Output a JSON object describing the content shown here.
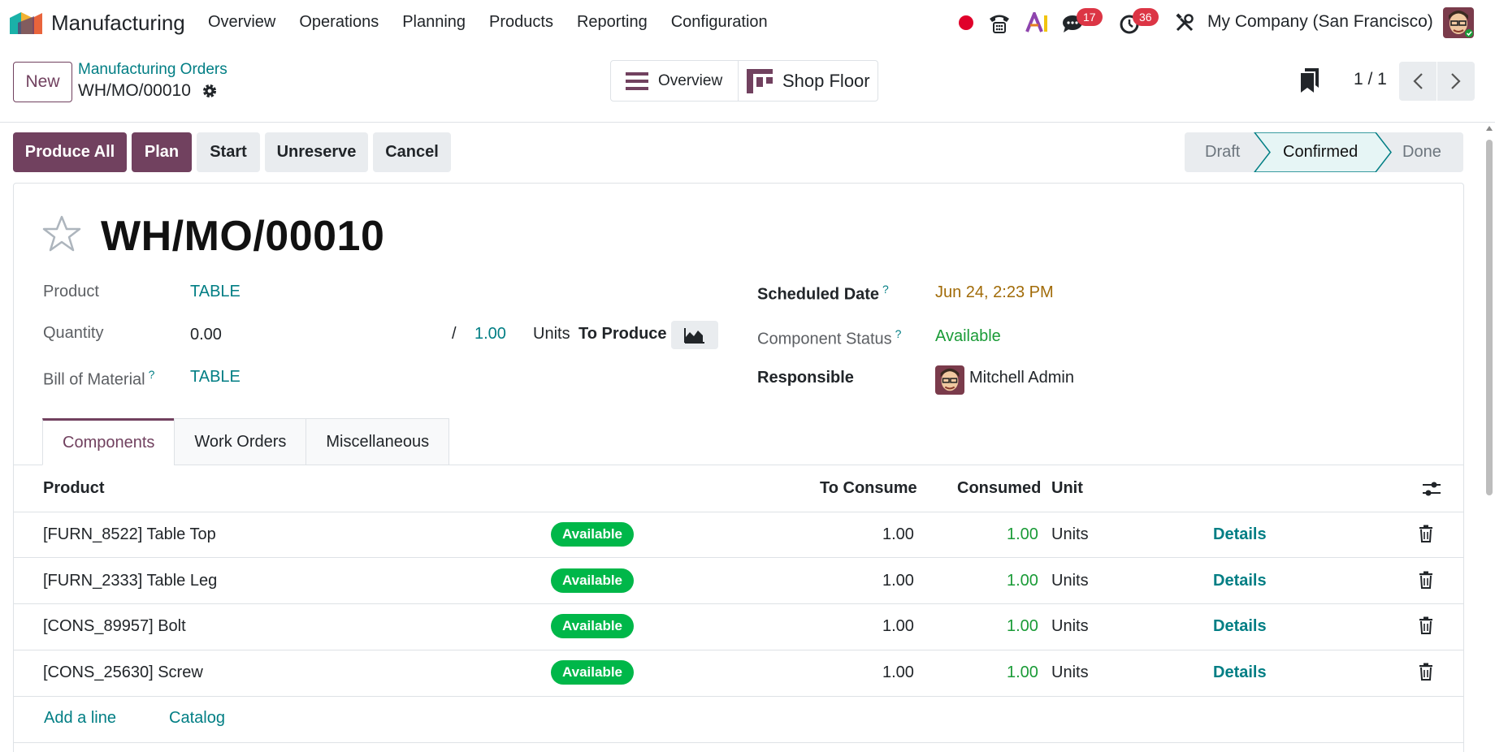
{
  "navbar": {
    "app_name": "Manufacturing",
    "menu": [
      "Overview",
      "Operations",
      "Planning",
      "Products",
      "Reporting",
      "Configuration"
    ],
    "messages_count": "17",
    "activities_count": "36",
    "company": "My Company (San Francisco)"
  },
  "control": {
    "new_label": "New",
    "breadcrumb_parent": "Manufacturing Orders",
    "breadcrumb_current": "WH/MO/00010",
    "view_overview": "Overview",
    "view_shopfloor": "Shop Floor",
    "pager": "1 / 1"
  },
  "statusbar": {
    "buttons": {
      "produce_all": "Produce All",
      "plan": "Plan",
      "start": "Start",
      "unreserve": "Unreserve",
      "cancel": "Cancel"
    },
    "stages": [
      "Draft",
      "Confirmed",
      "Done"
    ],
    "current_stage": "Confirmed"
  },
  "form": {
    "title": "WH/MO/00010",
    "product_label": "Product",
    "product_value": "TABLE",
    "quantity_label": "Quantity",
    "quantity_value": "0.00",
    "quantity_sep": "/",
    "quantity_target": "1.00",
    "quantity_uom": "Units",
    "to_produce": "To Produce",
    "bom_label": "Bill of Material",
    "bom_value": "TABLE",
    "scheduled_label": "Scheduled Date",
    "scheduled_value": "Jun 24, 2:23 PM",
    "component_status_label": "Component Status",
    "component_status_value": "Available",
    "responsible_label": "Responsible",
    "responsible_value": "Mitchell Admin",
    "help_mark": "?"
  },
  "tabs": [
    "Components",
    "Work Orders",
    "Miscellaneous"
  ],
  "components": {
    "headers": {
      "product": "Product",
      "to_consume": "To Consume",
      "consumed": "Consumed",
      "unit": "Unit"
    },
    "rows": [
      {
        "product": "[FURN_8522] Table Top",
        "status": "Available",
        "to_consume": "1.00",
        "consumed": "1.00",
        "unit": "Units",
        "action": "Details"
      },
      {
        "product": "[FURN_2333] Table Leg",
        "status": "Available",
        "to_consume": "1.00",
        "consumed": "1.00",
        "unit": "Units",
        "action": "Details"
      },
      {
        "product": "[CONS_89957] Bolt",
        "status": "Available",
        "to_consume": "1.00",
        "consumed": "1.00",
        "unit": "Units",
        "action": "Details"
      },
      {
        "product": "[CONS_25630] Screw",
        "status": "Available",
        "to_consume": "1.00",
        "consumed": "1.00",
        "unit": "Units",
        "action": "Details"
      }
    ],
    "add_line": "Add a line",
    "catalog": "Catalog"
  },
  "colors": {
    "primary": "#71415f",
    "link": "#017e84",
    "success": "#00b749",
    "danger": "#dc3545"
  }
}
